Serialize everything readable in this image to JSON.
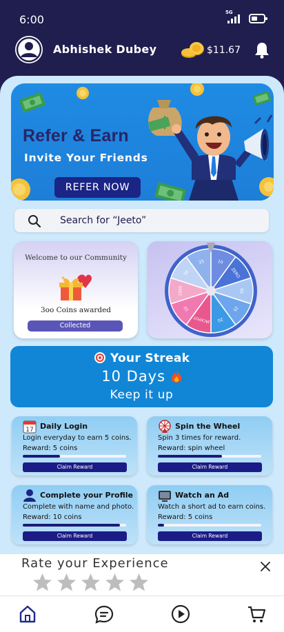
{
  "status_bar": {
    "time": "6:00",
    "network": "5G"
  },
  "header": {
    "user_name": "Abhishek Dubey",
    "balance": "$11.67"
  },
  "banner": {
    "title": "Refer & Earn",
    "subtitle": "Invite Your Friends",
    "button_label": "REFER NOW"
  },
  "search": {
    "placeholder": "Search for “Jeeto”"
  },
  "community": {
    "title": "Welcome to our Community",
    "awarded": "3oo Coins awarded",
    "button_label": "Collected"
  },
  "wheel": {
    "segments": [
      "10",
      "ZERO",
      "50",
      "25",
      "20",
      "JACKPOT",
      "10",
      "1000",
      "50",
      "25"
    ]
  },
  "streak": {
    "title": "Your Streak",
    "days": "10 Days",
    "message": "Keep it up"
  },
  "tasks": [
    {
      "name": "Daily Login",
      "icon": "calendar-icon",
      "calendar_number": "17",
      "description": "Login everyday to earn 5 coins.",
      "reward": "Reward: 5 coins",
      "progress": 0.36,
      "button_label": "Claim Reward"
    },
    {
      "name": "Spin the Wheel",
      "icon": "wheel-icon",
      "description": "Spin 3 times for reward.",
      "reward": "Reward: spin wheel",
      "progress": 0.62,
      "button_label": "Claim Reward"
    },
    {
      "name": "Complete your Profile",
      "icon": "person-icon",
      "description": "Complete with name and photo.",
      "reward": "Reward: 10 coins",
      "progress": 0.94,
      "button_label": "Claim Reward"
    },
    {
      "name": "Watch an Ad",
      "icon": "tv-icon",
      "description": "Watch a short ad to earn coins.",
      "reward": "Reward: 5 coins",
      "progress": 0.06,
      "button_label": "Claim Reward"
    }
  ],
  "rate": {
    "title": "Rate your Experience",
    "stars_total": 5,
    "stars_selected": 0
  },
  "colors": {
    "header_bg": "#201d4f",
    "panel_bg": "#cde9fb",
    "accent": "#1186d6",
    "button_dark": "#1c1c86"
  }
}
